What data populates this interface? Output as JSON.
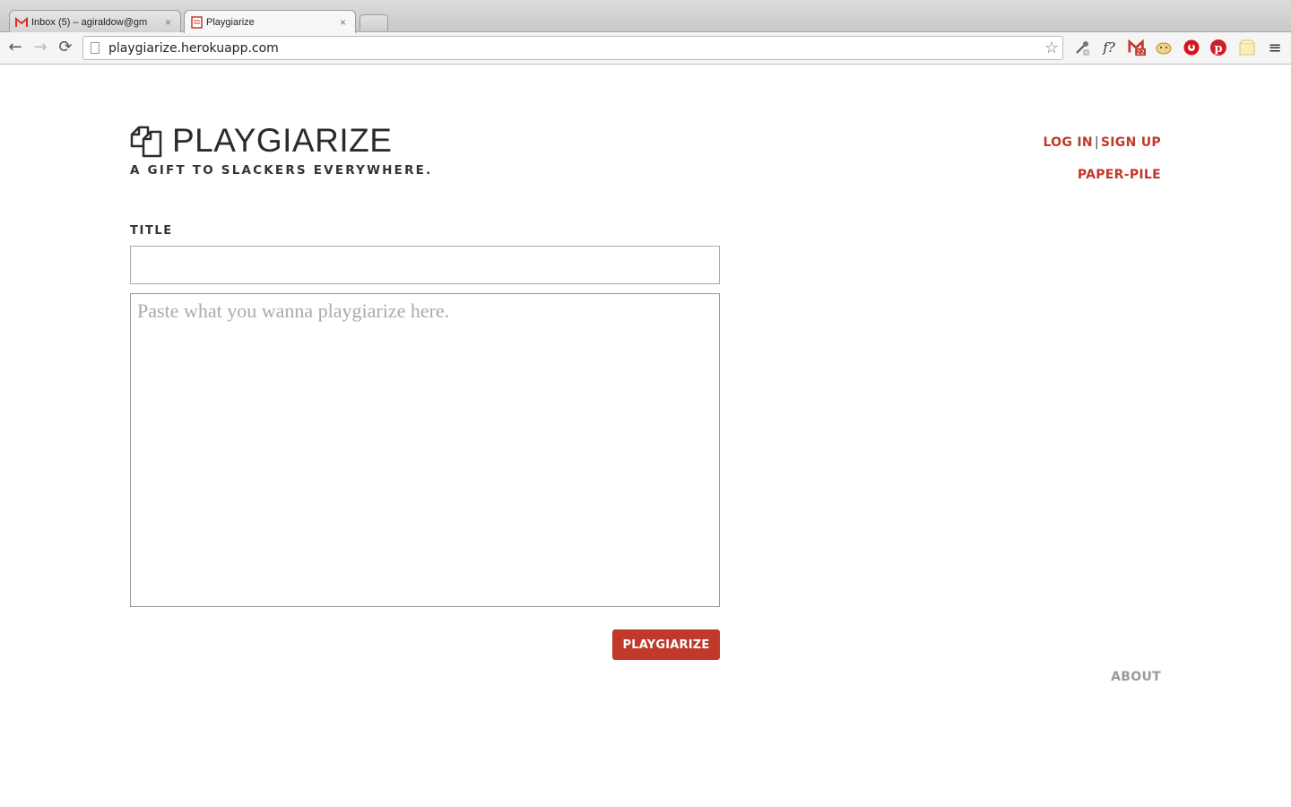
{
  "browser": {
    "tabs": [
      {
        "title": "Inbox (5) – agiraldow@gm",
        "close": "×",
        "favicon": "gmail-icon",
        "active": false
      },
      {
        "title": "Playgiarize",
        "close": "×",
        "favicon": "playgiarize-favicon",
        "active": true
      }
    ],
    "url": "playgiarize.herokuapp.com",
    "nav": {
      "back": "←",
      "forward": "→",
      "reload": "⟳"
    },
    "bookmark_star": "☆",
    "extensions": [
      {
        "name": "eyedropper-extension-icon"
      },
      {
        "name": "formula-extension-icon",
        "label": "f?"
      },
      {
        "name": "gmail-checker-icon",
        "badge": "22"
      },
      {
        "name": "hamster-extension-icon"
      },
      {
        "name": "opera-extension-icon"
      },
      {
        "name": "pinterest-extension-icon"
      },
      {
        "name": "notes-extension-icon"
      },
      {
        "name": "menu-icon",
        "label": "≡"
      }
    ]
  },
  "header": {
    "brand": "PLAYGIARIZE",
    "tagline": "A GIFT TO SLACKERS EVERYWHERE.",
    "login": "LOG IN",
    "separator": "|",
    "signup": "SIGN UP",
    "paper_pile": "PAPER-PILE"
  },
  "form": {
    "title_label": "TITLE",
    "title_value": "",
    "body_placeholder": "Paste what you wanna playgiarize here.",
    "body_value": "",
    "submit_label": "PLAYGIARIZE"
  },
  "footer": {
    "about": "ABOUT"
  },
  "colors": {
    "accent": "#c0392b",
    "text": "#2b2b2b",
    "muted": "#9a9a9a"
  }
}
